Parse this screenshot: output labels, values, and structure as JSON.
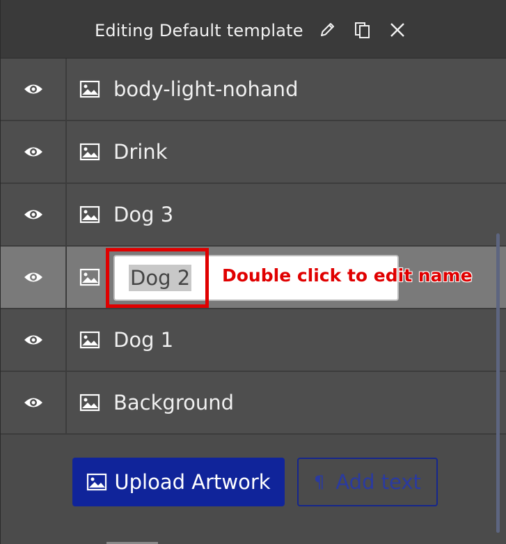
{
  "header": {
    "title": "Editing Default template",
    "icons": [
      "pencil-icon",
      "duplicate-icon",
      "close-icon"
    ]
  },
  "layers": [
    {
      "name": "body-light-nohand",
      "visible": true,
      "selected": false
    },
    {
      "name": "Drink",
      "visible": true,
      "selected": false
    },
    {
      "name": "Dog 3",
      "visible": true,
      "selected": false
    },
    {
      "name": "Dog 2",
      "visible": true,
      "selected": true,
      "editing": true
    },
    {
      "name": "Dog 1",
      "visible": true,
      "selected": false
    },
    {
      "name": "Background",
      "visible": true,
      "selected": false
    }
  ],
  "annotation": {
    "text": "Double click to edit name",
    "color": "#e00000"
  },
  "actions": {
    "upload_label": "Upload Artwork",
    "add_text_label": "Add text",
    "upload_icon": "image-icon",
    "add_text_icon": "pilcrow-icon"
  },
  "colors": {
    "accent": "#10249a",
    "header_bg": "#3a3a3a",
    "panel_bg": "#4e4e4e",
    "selected_row": "#7a7a7a"
  }
}
